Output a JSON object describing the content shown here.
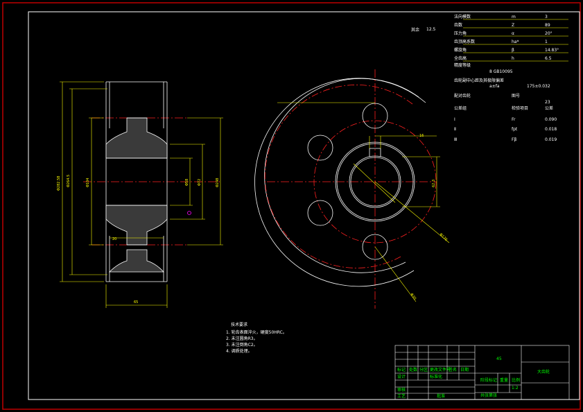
{
  "colors": {
    "background": "#000000",
    "outer_frame": "#c00000",
    "inner_frame": "#ffffff",
    "outline": "#ffffff",
    "centerline": "#ff2020",
    "dimension": "#ffff00",
    "hatch": "#ffffff",
    "title_text": "#00ff00",
    "magenta": "#ff00ff"
  },
  "roughness_note": {
    "label": "其余",
    "value": "12.5"
  },
  "parameter_table": {
    "rows": [
      {
        "name": "法向模数",
        "symbol": "m",
        "value": "3"
      },
      {
        "name": "齿数",
        "symbol": "Z",
        "value": "89"
      },
      {
        "name": "压力角",
        "symbol": "α",
        "value": "20°"
      },
      {
        "name": "齿顶高系数",
        "symbol": "ha*",
        "value": "1"
      },
      {
        "name": "螺旋角",
        "symbol": "β",
        "value": "14.83°"
      },
      {
        "name": "全齿高",
        "symbol": "h",
        "value": "6.5"
      },
      {
        "name": "精度等级",
        "symbol": "",
        "value": ""
      },
      {
        "name": "齿轮副中心距及其极限偏差",
        "symbol": "",
        "value": ""
      },
      {
        "name": "配对齿轮",
        "symbol": "图号",
        "value": ""
      },
      {
        "name": "公差组",
        "symbol": "检验项目",
        "value": "公差"
      },
      {
        "name": "Ⅰ",
        "symbol": "Fr",
        "value": "0.090"
      },
      {
        "name": "Ⅱ",
        "symbol": "fpt",
        "value": "0.018"
      },
      {
        "name": "Ⅲ",
        "symbol": "Fβ",
        "value": "0.019"
      }
    ],
    "extra": {
      "precision": "8 GB10095",
      "center_distance": "a±fa",
      "center_value": "175±0.032",
      "gear_no": "23",
      "symbol_col": "z",
      "tolerance_col": "8"
    }
  },
  "front_view": {
    "dimensions": {
      "tip_diameter": "Φ282.58",
      "root_diameter": "Φ264.5",
      "hub_diameter": "Φ104",
      "bore_diameter": "Φ58",
      "web_diameter": "Φ72",
      "rim_inner_diameter": "Φ248",
      "width": "65",
      "web_thickness": "20"
    }
  },
  "side_view": {
    "dimensions": {
      "keyway_width": "16",
      "keyway_depth": "62.3",
      "hole_circle_diameter": "Φ176",
      "hole_diameter": "Φ30"
    }
  },
  "tech_requirements": {
    "title": "技术要求",
    "items": [
      "1. 轮齿表面淬火，硬度50HRC。",
      "2. 未注圆角R3。",
      "3. 未注倒角C2。",
      "4. 调质处理。"
    ]
  },
  "title_block": {
    "part_name": "大齿轮",
    "material": "45",
    "scale_label": "比例",
    "scale_value": "1:2",
    "labels": {
      "designed": "设计",
      "checked": "审核",
      "standard": "标准化",
      "approved": "批准",
      "process": "工艺",
      "date": "日期",
      "mark": "标记",
      "count": "处数",
      "zone": "分区",
      "doc_no": "更改文件号",
      "sign": "签名",
      "stage": "阶段标记",
      "weight": "重量",
      "sheet": "共张第张"
    }
  }
}
